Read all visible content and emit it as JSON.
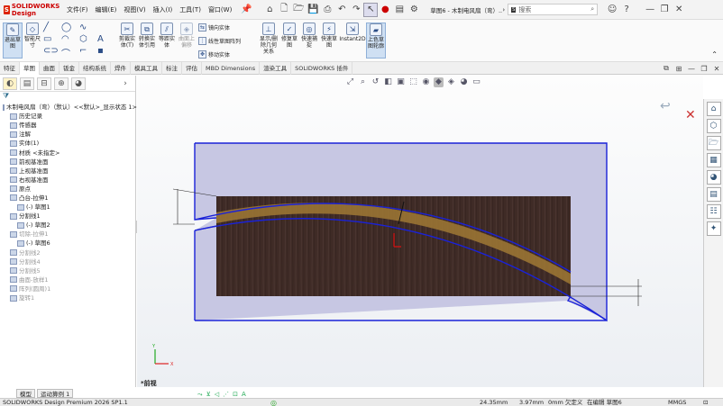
{
  "titlebar": {
    "app_name": "SOLIDWORKS Design",
    "menus": [
      "文件(F)",
      "编辑(E)",
      "视图(V)",
      "插入(I)",
      "工具(T)",
      "窗口(W)"
    ],
    "document_title": "草图6 - 木制电风扇（弯）...",
    "search_placeholder": "搜索"
  },
  "ribbon": {
    "large_buttons": [
      {
        "label": "退出草图",
        "icon": "exit-sketch-icon"
      },
      {
        "label": "智能尺寸",
        "icon": "smart-dimension-icon"
      },
      {
        "label": "剪裁实体(T)",
        "icon": "trim-icon"
      },
      {
        "label": "转换实体引用",
        "icon": "convert-entities-icon"
      },
      {
        "label": "等距实体",
        "icon": "offset-entities-icon"
      },
      {
        "label": "曲面上偏移",
        "icon": "offset-on-surface-icon"
      },
      {
        "label": "显示/删除几何关系",
        "icon": "relations-icon"
      },
      {
        "label": "修复草图",
        "icon": "repair-sketch-icon"
      },
      {
        "label": "快速捕捉",
        "icon": "quick-snap-icon"
      },
      {
        "label": "快速草图",
        "icon": "rapid-sketch-icon"
      },
      {
        "label": "Instant2D",
        "icon": "instant2d-icon"
      },
      {
        "label": "上色草图轮廓",
        "icon": "shaded-sketch-icon"
      }
    ],
    "small_buttons": [
      {
        "label": "镜向实体",
        "icon": "mirror-icon"
      },
      {
        "label": "线性草图阵列",
        "icon": "linear-pattern-icon"
      },
      {
        "label": "移动实体",
        "icon": "move-entities-icon"
      }
    ]
  },
  "tabs": [
    "特征",
    "草图",
    "曲面",
    "钣金",
    "结构系统",
    "焊件",
    "模具工具",
    "标注",
    "评估",
    "MBD Dimensions",
    "渲染工具",
    "SOLIDWORKS 插件"
  ],
  "active_tab": "草图",
  "tree": [
    {
      "label": "木制电风扇（弯）（默认）<<默认>_显示状态 1>",
      "indent": 0,
      "grey": false
    },
    {
      "label": "历史记录",
      "indent": 1,
      "grey": false
    },
    {
      "label": "传感器",
      "indent": 1,
      "grey": false
    },
    {
      "label": "注解",
      "indent": 1,
      "grey": false
    },
    {
      "label": "实体(1)",
      "indent": 1,
      "grey": false
    },
    {
      "label": "材质 <未指定>",
      "indent": 1,
      "grey": false
    },
    {
      "label": "前视基准面",
      "indent": 1,
      "grey": false
    },
    {
      "label": "上视基准面",
      "indent": 1,
      "grey": false
    },
    {
      "label": "右视基准面",
      "indent": 1,
      "grey": false
    },
    {
      "label": "原点",
      "indent": 1,
      "grey": false
    },
    {
      "label": "凸台-拉伸1",
      "indent": 1,
      "grey": false
    },
    {
      "label": "(-) 草图1",
      "indent": 2,
      "grey": false
    },
    {
      "label": "分割线1",
      "indent": 1,
      "grey": false
    },
    {
      "label": "(-) 草图2",
      "indent": 2,
      "grey": false
    },
    {
      "label": "切除-拉伸1",
      "indent": 1,
      "grey": true
    },
    {
      "label": "(-) 草图6",
      "indent": 2,
      "grey": false
    },
    {
      "label": "分割线2",
      "indent": 1,
      "grey": true
    },
    {
      "label": "分割线4",
      "indent": 1,
      "grey": true
    },
    {
      "label": "分割线5",
      "indent": 1,
      "grey": true
    },
    {
      "label": "曲面-放样1",
      "indent": 1,
      "grey": true
    },
    {
      "label": "阵列(圆周)1",
      "indent": 1,
      "grey": true
    },
    {
      "label": "旋转1",
      "indent": 1,
      "grey": true
    }
  ],
  "graphics": {
    "view_label": "*前视",
    "colors": {
      "sketch_blue": "#1a22d8",
      "body_fill": "#c7c7e3",
      "wood": "#3f2b26",
      "grain": "#9a7434"
    }
  },
  "model_tabs": [
    "模型",
    "运动算例 1"
  ],
  "statusbar": {
    "product": "SOLIDWORKS Design Premium 2026 SP1.1",
    "x": "24.35mm",
    "y": "3.97mm",
    "z": "0mm 欠定义",
    "editing": "在编辑 草图6",
    "units": "MMGS"
  }
}
